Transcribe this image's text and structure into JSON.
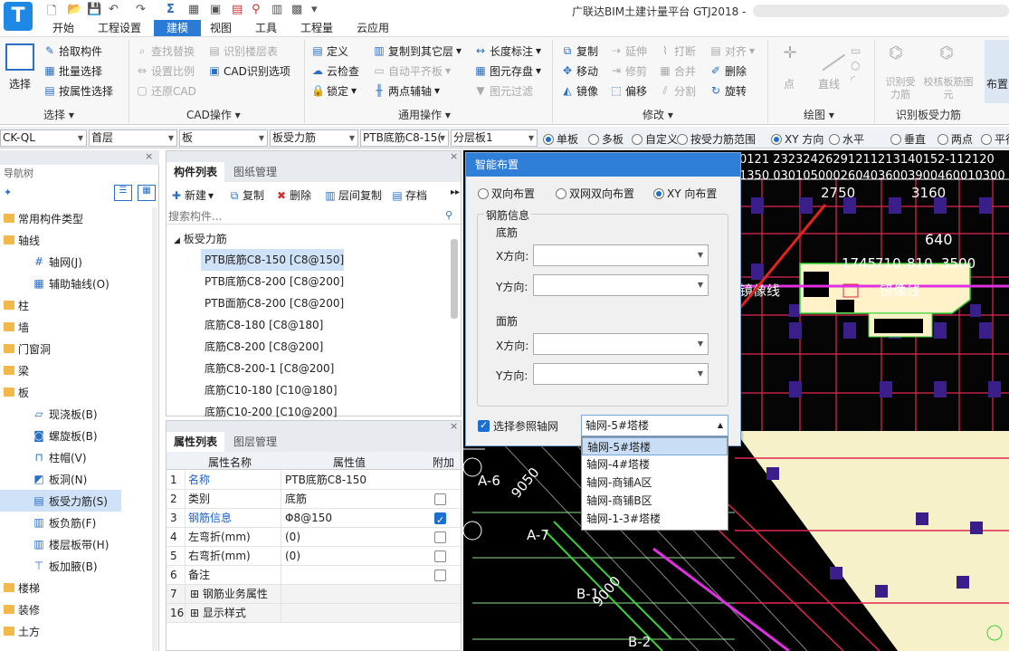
{
  "app": {
    "title": "广联达BIM土建计量平台 GTJ2018 -",
    "logo_letter": "T"
  },
  "ribbon_tabs": [
    "开始",
    "工程设置",
    "建模",
    "视图",
    "工具",
    "工程量",
    "云应用"
  ],
  "ribbon": {
    "select": {
      "label": "选择",
      "group": "选择"
    },
    "select_items": [
      "拾取构件",
      "批量选择",
      "按属性选择"
    ],
    "cad_items": [
      "查找替换",
      "识别楼层表",
      "设置比例",
      "CAD识别选项",
      "还原CAD"
    ],
    "cad_group": "CAD操作",
    "general_items": [
      "定义",
      "复制到其它层",
      "长度标注",
      "云检查",
      "自动平齐板",
      "图元存盘",
      "锁定",
      "两点辅轴",
      "图元过滤"
    ],
    "general_group": "通用操作",
    "modify_items": [
      "复制",
      "延伸",
      "打断",
      "对齐",
      "移动",
      "修剪",
      "合并",
      "删除",
      "镜像",
      "偏移",
      "分割",
      "旋转"
    ],
    "modify_group": "修改",
    "draw_items": [
      "点",
      "直线"
    ],
    "draw_group": "绘图",
    "recog_items": [
      "识别受力筋",
      "校核板筋图元"
    ],
    "recog_group": "识别板受力筋",
    "layout_label": "布置"
  },
  "filterbar": {
    "combos": [
      "CK-QL",
      "首层",
      "板",
      "板受力筋",
      "PTB底筋C8-15(",
      "分层板1"
    ],
    "radios": [
      {
        "label": "单板",
        "checked": true
      },
      {
        "label": "多板",
        "checked": false
      },
      {
        "label": "自定义",
        "checked": false
      },
      {
        "label": "按受力筋范围",
        "checked": false
      },
      {
        "label": "XY 方向",
        "checked": true
      },
      {
        "label": "水平",
        "checked": false
      },
      {
        "label": "垂直",
        "checked": false
      },
      {
        "label": "两点",
        "checked": false
      },
      {
        "label": "平行边",
        "checked": false
      }
    ]
  },
  "nav": {
    "title": "导航树",
    "items": [
      {
        "label": "常用构件类型",
        "level": 0
      },
      {
        "label": "轴线",
        "level": 0
      },
      {
        "label": "轴网(J)",
        "level": 1,
        "icon": "grid-icon"
      },
      {
        "label": "辅助轴线(O)",
        "level": 1,
        "icon": "aux-grid-icon"
      },
      {
        "label": "柱",
        "level": 0
      },
      {
        "label": "墙",
        "level": 0
      },
      {
        "label": "门窗洞",
        "level": 0
      },
      {
        "label": "梁",
        "level": 0
      },
      {
        "label": "板",
        "level": 0
      },
      {
        "label": "现浇板(B)",
        "level": 1,
        "icon": "slab-icon"
      },
      {
        "label": "螺旋板(B)",
        "level": 1,
        "icon": "spiral-slab-icon"
      },
      {
        "label": "柱帽(V)",
        "level": 1,
        "icon": "column-cap-icon"
      },
      {
        "label": "板洞(N)",
        "level": 1,
        "icon": "slab-hole-icon"
      },
      {
        "label": "板受力筋(S)",
        "level": 1,
        "icon": "slab-rebar-icon",
        "selected": true
      },
      {
        "label": "板负筋(F)",
        "level": 1,
        "icon": "negative-rebar-icon"
      },
      {
        "label": "楼层板带(H)",
        "level": 1,
        "icon": "slab-band-icon"
      },
      {
        "label": "板加腋(B)",
        "level": 1,
        "icon": "haunch-icon"
      },
      {
        "label": "楼梯",
        "level": 0
      },
      {
        "label": "装修",
        "level": 0
      },
      {
        "label": "土方",
        "level": 0
      }
    ]
  },
  "components": {
    "tabs": [
      "构件列表",
      "图纸管理"
    ],
    "toolbar": [
      "新建",
      "复制",
      "删除",
      "层间复制",
      "存档"
    ],
    "search_placeholder": "搜索构件...",
    "group": "板受力筋",
    "items": [
      {
        "label": "PTB底筋C8-150 [C8@150]",
        "selected": true
      },
      {
        "label": "PTB底筋C8-200 [C8@200]"
      },
      {
        "label": "PTB面筋C8-200 [C8@200]"
      },
      {
        "label": "底筋C8-180 [C8@180]"
      },
      {
        "label": "底筋C8-200 [C8@200]"
      },
      {
        "label": "底筋C8-200-1 [C8@200]"
      },
      {
        "label": "底筋C10-180 [C10@180]"
      },
      {
        "label": "底筋C10-200 [C10@200]"
      }
    ]
  },
  "properties": {
    "tabs": [
      "属性列表",
      "图层管理"
    ],
    "headers": [
      "属性名称",
      "属性值",
      "附加"
    ],
    "rows": [
      {
        "no": "1",
        "name": "名称",
        "value": "PTB底筋C8-150",
        "blue": true,
        "check": null
      },
      {
        "no": "2",
        "name": "类别",
        "value": "底筋",
        "blue": false,
        "check": false
      },
      {
        "no": "3",
        "name": "钢筋信息",
        "value": "Φ8@150",
        "blue": true,
        "check": true
      },
      {
        "no": "4",
        "name": "左弯折(mm)",
        "value": "(0)",
        "blue": false,
        "check": false
      },
      {
        "no": "5",
        "name": "右弯折(mm)",
        "value": "(0)",
        "blue": false,
        "check": false
      },
      {
        "no": "6",
        "name": "备注",
        "value": "",
        "blue": false,
        "check": false
      },
      {
        "no": "7",
        "name": "钢筋业务属性",
        "value": "",
        "blue": false,
        "check": null,
        "expand": true
      },
      {
        "no": "16",
        "name": "显示样式",
        "value": "",
        "blue": false,
        "check": null,
        "expand": true
      }
    ]
  },
  "dialog": {
    "title": "智能布置",
    "modes": [
      {
        "label": "双向布置",
        "checked": false
      },
      {
        "label": "双网双向布置",
        "checked": false
      },
      {
        "label": "XY 向布置",
        "checked": true
      }
    ],
    "rebar_group": "钢筋信息",
    "bottom_label": "底筋",
    "top_label": "面筋",
    "x_label": "X方向:",
    "y_label": "Y方向:",
    "ref_axis_label": "选择参照轴网",
    "ref_axis_checked": true,
    "ref_axis_value": "轴网-5#塔楼",
    "options": [
      "轴网-5#塔楼",
      "轴网-4#塔楼",
      "轴网-商铺A区",
      "轴网-商铺B区",
      "轴网-1-3#塔楼"
    ]
  },
  "cad_labels": [
    "2750",
    "3160",
    "640",
    "1745",
    "710",
    "810",
    "3500",
    "A-6",
    "A-7",
    "B-1",
    "B-2",
    "9050",
    "9000",
    "镜像线",
    "镜像线"
  ]
}
